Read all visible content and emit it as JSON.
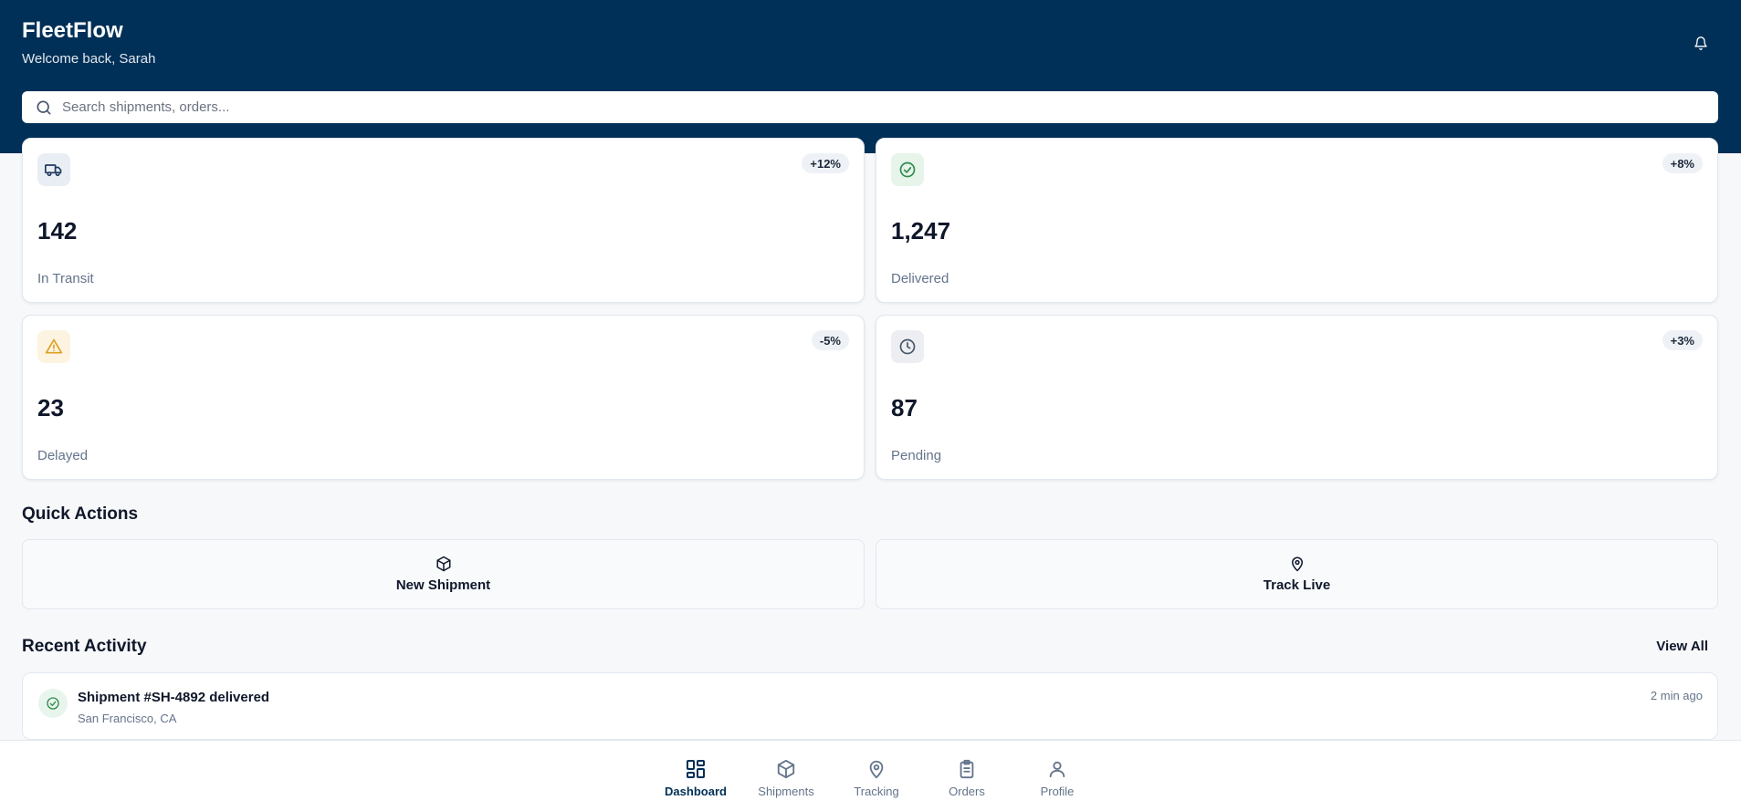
{
  "header": {
    "title": "FleetFlow",
    "subtitle": "Welcome back, Sarah",
    "bell_icon": "bell-icon",
    "background": "#003057"
  },
  "search": {
    "placeholder": "Search shipments, orders...",
    "value": ""
  },
  "stats": [
    {
      "icon": "truck-icon",
      "badge": "+12%",
      "value": "142",
      "label": "In Transit",
      "icon_bg": "#e9eef4"
    },
    {
      "icon": "check-circle-icon",
      "badge": "+8%",
      "value": "1,247",
      "label": "Delivered",
      "icon_bg": "#e6f4ea"
    },
    {
      "icon": "warning-icon",
      "badge": "-5%",
      "value": "23",
      "label": "Delayed",
      "icon_bg": "#fdf3e1"
    },
    {
      "icon": "clock-icon",
      "badge": "+3%",
      "value": "87",
      "label": "Pending",
      "icon_bg": "#eceef2"
    }
  ],
  "quick_actions": {
    "title": "Quick Actions",
    "items": [
      {
        "icon": "package-icon",
        "label": "New Shipment"
      },
      {
        "icon": "map-pin-icon",
        "label": "Track Live"
      }
    ]
  },
  "recent_activity": {
    "title": "Recent Activity",
    "view_all": "View All",
    "items": [
      {
        "icon": "check-circle-icon",
        "title": "Shipment #SH-4892 delivered",
        "subtitle": "San Francisco, CA",
        "time": "2 min ago"
      }
    ]
  },
  "bottom_nav": {
    "active": "Dashboard",
    "items": [
      {
        "icon": "dashboard-icon",
        "label": "Dashboard"
      },
      {
        "icon": "package-icon",
        "label": "Shipments"
      },
      {
        "icon": "map-pin-icon",
        "label": "Tracking"
      },
      {
        "icon": "clipboard-icon",
        "label": "Orders"
      },
      {
        "icon": "user-icon",
        "label": "Profile"
      }
    ]
  },
  "colors": {
    "accent": "#003057",
    "success": "#2e8b4a",
    "warning": "#e0a020"
  }
}
